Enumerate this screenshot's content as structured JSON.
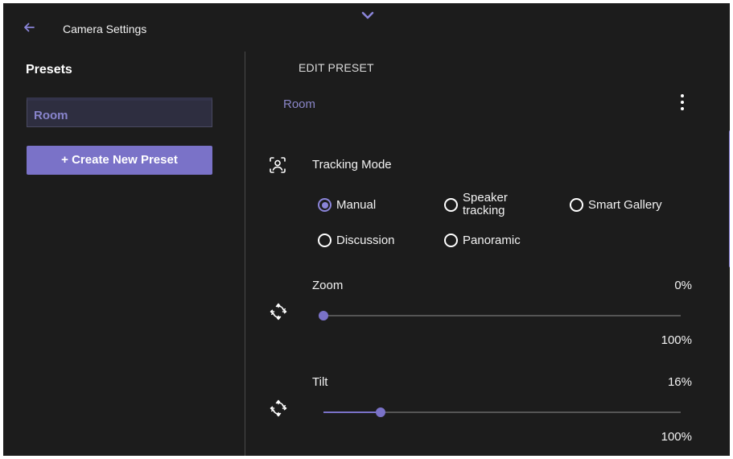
{
  "header": {
    "title": "Camera Settings",
    "back_icon": "arrow-left-icon",
    "collapse_icon": "chevron-down-icon"
  },
  "sidebar": {
    "heading": "Presets",
    "items": [
      {
        "label": "Room",
        "selected": true
      }
    ],
    "create_button": "+ Create New Preset"
  },
  "editor": {
    "heading": "EDIT PRESET",
    "preset_name": "Room",
    "menu_icon": "more-vertical-icon",
    "tracking": {
      "label": "Tracking Mode",
      "icon": "face-frame-icon",
      "options": [
        {
          "label": "Manual",
          "selected": true
        },
        {
          "label_line1": "Speaker",
          "label_line2": "tracking",
          "selected": false
        },
        {
          "label": "Smart Gallery",
          "selected": false
        },
        {
          "label": "Discussion",
          "selected": false
        },
        {
          "label": "Panoramic",
          "selected": false
        }
      ]
    },
    "zoom": {
      "label": "Zoom",
      "value_text": "0%",
      "max_text": "100%",
      "value": 0,
      "icon": "ptz-icon"
    },
    "tilt": {
      "label": "Tilt",
      "value_text": "16%",
      "max_text": "100%",
      "value": 16,
      "icon": "ptz-icon"
    }
  },
  "colors": {
    "accent": "#7a72c8",
    "background": "#1c1c1c",
    "text": "#f2f2f2"
  }
}
